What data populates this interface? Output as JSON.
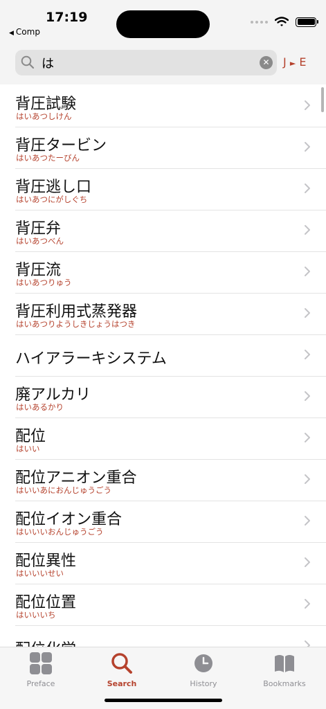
{
  "status_bar": {
    "time": "17:19",
    "back_label": "Comp"
  },
  "search": {
    "query": "は",
    "direction_from": "J",
    "direction_to": "E"
  },
  "results": [
    {
      "term": "背圧試験",
      "reading": "はいあつしけん"
    },
    {
      "term": "背圧タービン",
      "reading": "はいあつたーびん"
    },
    {
      "term": "背圧逃し口",
      "reading": "はいあつにがしぐち"
    },
    {
      "term": "背圧弁",
      "reading": "はいあつべん"
    },
    {
      "term": "背圧流",
      "reading": "はいあつりゅう"
    },
    {
      "term": "背圧利用式蒸発器",
      "reading": "はいあつりようしきじょうはつき"
    },
    {
      "term": "ハイアラーキシステム",
      "reading": ""
    },
    {
      "term": "廃アルカリ",
      "reading": "はいあるかり"
    },
    {
      "term": "配位",
      "reading": "はいい"
    },
    {
      "term": "配位アニオン重合",
      "reading": "はいいあにおんじゅうごう"
    },
    {
      "term": "配位イオン重合",
      "reading": "はいいいおんじゅうごう"
    },
    {
      "term": "配位異性",
      "reading": "はいいいせい"
    },
    {
      "term": "配位位置",
      "reading": "はいいいち"
    },
    {
      "term": "配位化学",
      "reading": ""
    }
  ],
  "tabs": [
    {
      "label": "Preface",
      "icon": "grid-icon",
      "active": false
    },
    {
      "label": "Search",
      "icon": "search-icon",
      "active": true
    },
    {
      "label": "History",
      "icon": "clock-icon",
      "active": false
    },
    {
      "label": "Bookmarks",
      "icon": "book-icon",
      "active": false
    }
  ],
  "colors": {
    "accent": "#b5422d",
    "inactive_tab": "#8e8e93",
    "search_field_bg": "#e2e2e2"
  }
}
